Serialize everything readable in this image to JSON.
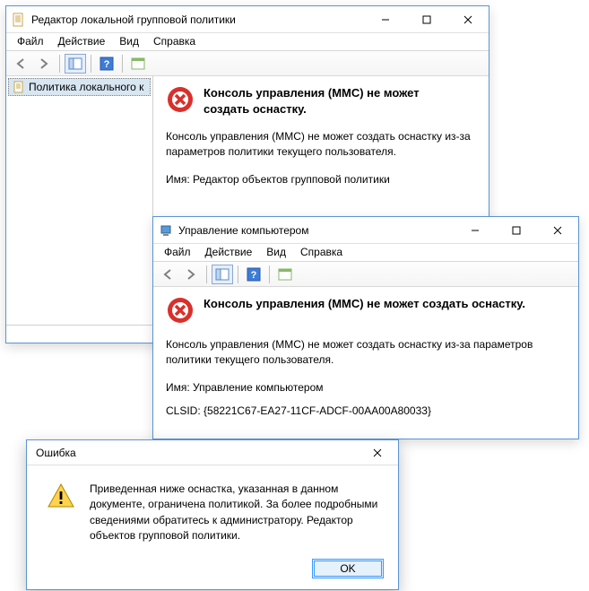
{
  "gpedit": {
    "title": "Редактор локальной групповой политики",
    "menu": {
      "file": "Файл",
      "action": "Действие",
      "view": "Вид",
      "help": "Справка"
    },
    "tree_item": "Политика локального к",
    "error_title_l1": "Консоль управления (MMC) не может",
    "error_title_l2": "создать оснастку.",
    "error_body": "Консоль управления (MMC) не может создать оснастку из-за параметров политики текущего пользователя.",
    "error_name": "Имя: Редактор объектов групповой политики"
  },
  "compmgmt": {
    "title": "Управление компьютером",
    "menu": {
      "file": "Файл",
      "action": "Действие",
      "view": "Вид",
      "help": "Справка"
    },
    "error_title": "Консоль управления (MMC) не может создать оснастку.",
    "error_body": "Консоль управления (MMC) не может создать оснастку из-за параметров политики текущего пользователя.",
    "error_name": "Имя: Управление компьютером",
    "error_clsid": "CLSID: {58221C67-EA27-11CF-ADCF-00AA00A80033}"
  },
  "dialog": {
    "title": "Ошибка",
    "text": "Приведенная ниже оснастка, указанная в данном документе, ограничена политикой. За более подробными сведениями обратитесь к администратору. Редактор объектов групповой политики.",
    "ok": "OK"
  }
}
